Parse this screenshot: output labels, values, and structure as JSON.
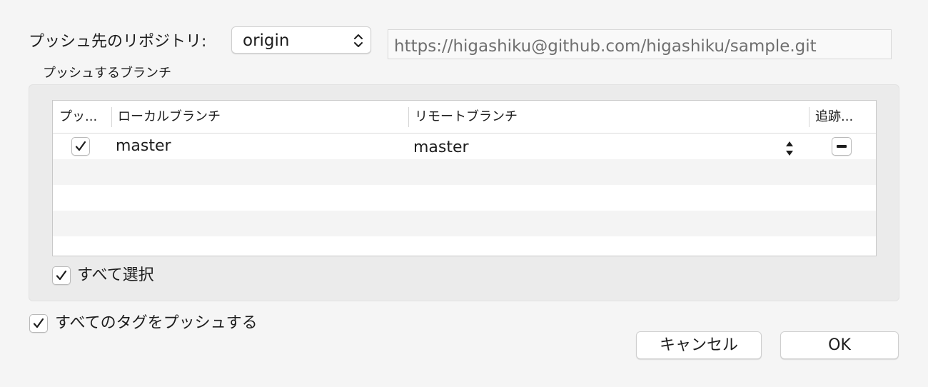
{
  "repository": {
    "label": "プッシュ先のリポジトリ:",
    "selected": "origin",
    "url": "https://higashiku@github.com/higashiku/sample.git"
  },
  "branches": {
    "group_title": "プッシュするブランチ",
    "columns": {
      "push": "プッ...",
      "local": "ローカルブランチ",
      "remote": "リモートブランチ",
      "track": "追跡..."
    },
    "rows": [
      {
        "push": true,
        "local": "master",
        "remote": "master",
        "track": "mixed"
      }
    ],
    "select_all_label": "すべて選択",
    "select_all_checked": true
  },
  "push_all_tags": {
    "label": "すべてのタグをプッシュする",
    "checked": true
  },
  "buttons": {
    "cancel": "キャンセル",
    "ok": "OK"
  }
}
